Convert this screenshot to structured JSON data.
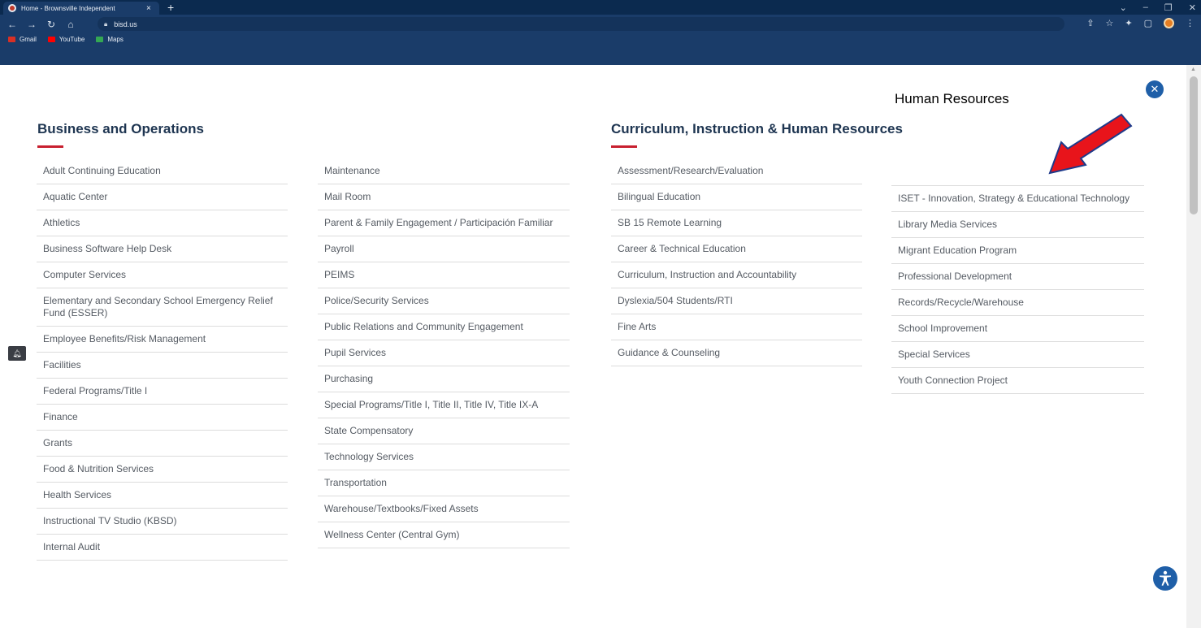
{
  "browser": {
    "tab_title": "Home - Brownsville Independent",
    "tab_close": "×",
    "new_tab": "+",
    "url": "bisd.us",
    "bookmarks": [
      {
        "label": "Gmail",
        "icon": "gmail-icon",
        "color": "#d93025"
      },
      {
        "label": "YouTube",
        "icon": "youtube-icon",
        "color": "#ff0000"
      },
      {
        "label": "Maps",
        "icon": "maps-icon",
        "color": "#34a853"
      }
    ]
  },
  "sections": {
    "business": {
      "title": "Business and Operations",
      "col1": [
        "Adult Continuing Education",
        "Aquatic Center",
        "Athletics",
        "Business Software Help Desk",
        "Computer Services",
        "Elementary and Secondary School Emergency Relief Fund (ESSER)",
        "Employee Benefits/Risk Management",
        "Facilities",
        "Federal Programs/Title I",
        "Finance",
        "Grants",
        "Food & Nutrition Services",
        "Health Services",
        "Instructional TV Studio (KBSD)",
        "Internal Audit"
      ],
      "col2": [
        "Maintenance",
        "Mail Room",
        "Parent & Family Engagement / Participación Familiar",
        "Payroll",
        "PEIMS",
        "Police/Security Services",
        "Public Relations and Community Engagement",
        "Pupil Services",
        "Purchasing",
        "Special Programs/Title I, Title II, Title IV, Title IX-A",
        "State Compensatory",
        "Technology Services",
        "Transportation",
        "Warehouse/Textbooks/Fixed Assets",
        "Wellness Center (Central Gym)"
      ]
    },
    "curriculum": {
      "title": "Curriculum, Instruction & Human Resources",
      "col1": [
        "Assessment/Research/Evaluation",
        "Bilingual Education",
        "SB 15 Remote Learning",
        "Career & Technical Education",
        "Curriculum, Instruction and Accountability",
        "Dyslexia/504 Students/RTI",
        "Fine Arts",
        "Guidance & Counseling"
      ],
      "col2_header": "Human Resources",
      "col2": [
        "ISET - Innovation, Strategy & Educational Technology",
        "Library Media Services",
        "Migrant Education Program",
        "Professional Development",
        "Records/Recycle/Warehouse",
        "School Improvement",
        "Special Services",
        "Youth Connection Project"
      ]
    }
  },
  "colors": {
    "accent": "#c8202f",
    "heading": "#1e3551",
    "brand_blue": "#1f5fa8",
    "annotation_arrow": "#e8141b"
  }
}
